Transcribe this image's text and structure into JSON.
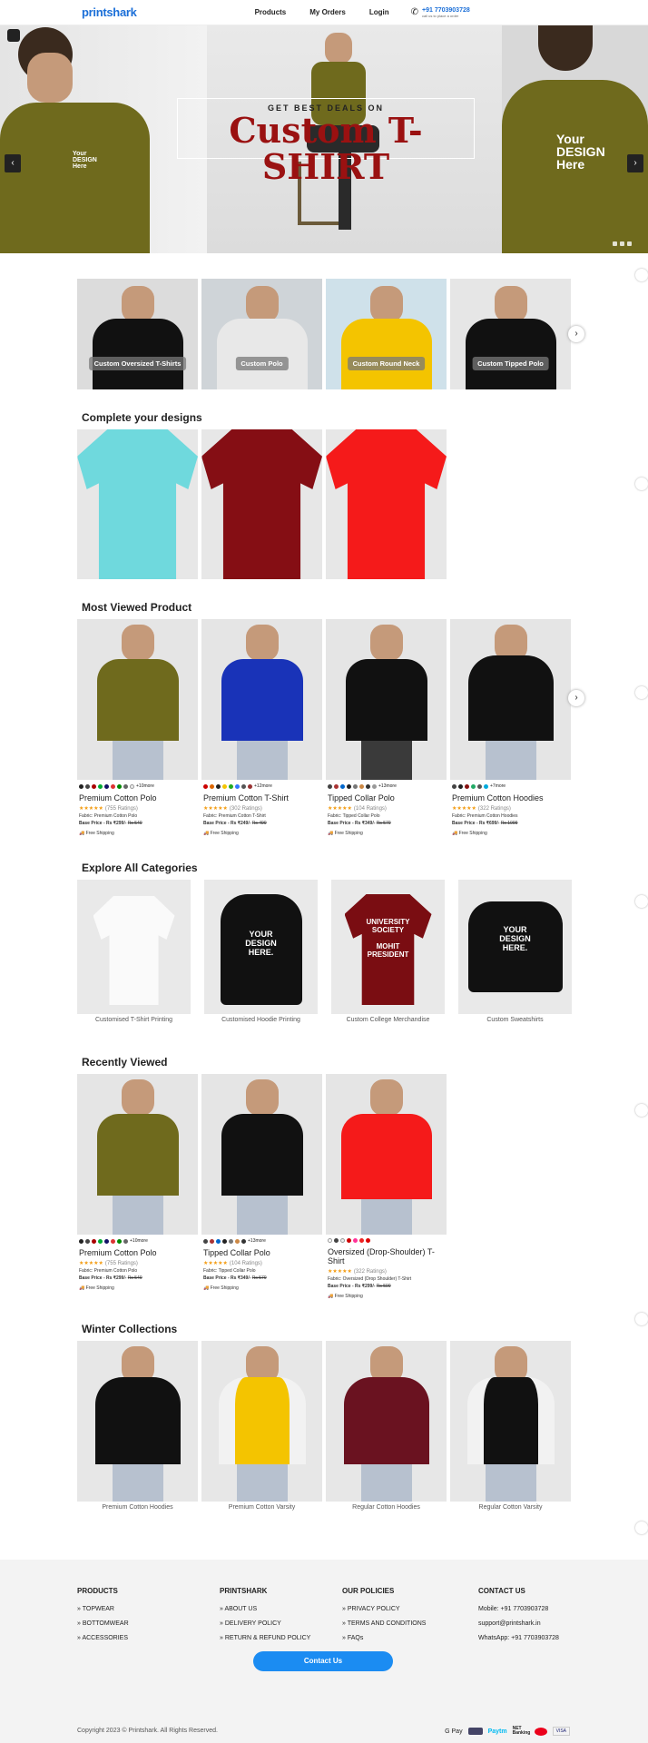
{
  "nav": {
    "logo": "printshark",
    "links": [
      "Products",
      "My Orders",
      "Login"
    ],
    "phone": "+91 7703903728",
    "phone_sub": "call us to place a order"
  },
  "hero": {
    "small": "GET BEST DEALS ON",
    "big": "Custom T-SHIRT",
    "prev": "‹",
    "next": "›"
  },
  "categories_strip": [
    "Custom Oversized T-Shirts",
    "Custom Polo",
    "Custom Round Neck",
    "Custom Tipped Polo"
  ],
  "complete": {
    "title": "Complete your designs"
  },
  "most_viewed": {
    "title": "Most Viewed Product",
    "items": [
      {
        "name": "Premium Cotton Polo",
        "ratings": "(755 Ratings)",
        "fabric": "Fabric: Premium Cotton Polo",
        "price": "Base Price - Rs ₹299/-",
        "old": "Rs 549",
        "more": "+10more",
        "ship": "Free Shipping",
        "colors": [
          "#222",
          "#444",
          "#a00",
          "#0a3",
          "#116",
          "#d33",
          "#080",
          "#666",
          "#eee"
        ]
      },
      {
        "name": "Premium Cotton T-Shirt",
        "ratings": "(302 Ratings)",
        "fabric": "Fabric: Premium Cotton T-Shirt",
        "price": "Base Price - Rs ₹249/-",
        "old": "Rs 499",
        "more": "+12more",
        "ship": "Free Shipping",
        "colors": [
          "#c00",
          "#d60",
          "#222",
          "#f4c400",
          "#2a2",
          "#37f",
          "#555",
          "#933"
        ]
      },
      {
        "name": "Tipped Collar Polo",
        "ratings": "(104 Ratings)",
        "fabric": "Fabric: Tipped Collar Polo",
        "price": "Base Price - Rs ₹349/-",
        "old": "Rs 579",
        "more": "+13more",
        "ship": "Free Shipping",
        "colors": [
          "#444",
          "#a33",
          "#06c",
          "#222",
          "#777",
          "#c84",
          "#333",
          "#999"
        ]
      },
      {
        "name": "Premium Cotton Hoodies",
        "ratings": "(322 Ratings)",
        "fabric": "Fabric: Premium Cotton Hoodies",
        "price": "Base Price - Rs ₹699/-",
        "old": "Rs 1099",
        "more": "+7more",
        "ship": "Free Shipping",
        "colors": [
          "#444",
          "#222",
          "#811",
          "#2a6",
          "#555",
          "#0ad"
        ]
      }
    ]
  },
  "explore": {
    "title": "Explore All Categories",
    "items": [
      "Customised T-Shirt Printing",
      "Customised Hoodie Printing",
      "Custom College Merchandise",
      "Custom Sweatshirts"
    ]
  },
  "recent": {
    "title": "Recently Viewed",
    "items": [
      {
        "name": "Premium Cotton Polo",
        "ratings": "(755 Ratings)",
        "fabric": "Fabric: Premium Cotton Polo",
        "price": "Base Price - Rs ₹299/-",
        "old": "Rs 549",
        "more": "+10more",
        "ship": "Free Shipping"
      },
      {
        "name": "Tipped Collar Polo",
        "ratings": "(104 Ratings)",
        "fabric": "Fabric: Tipped Collar Polo",
        "price": "Base Price - Rs ₹349/-",
        "old": "Rs 579",
        "more": "+13more",
        "ship": "Free Shipping"
      },
      {
        "name": "Oversized (Drop-Shoulder) T-Shirt",
        "ratings": "(322 Ratings)",
        "fabric": "Fabric: Oversized (Drop Shoulder) T-Shirt",
        "price": "Base Price - Rs ₹299/-",
        "old": "Rs 599",
        "more": "",
        "ship": "Free Shipping"
      }
    ]
  },
  "winter": {
    "title": "Winter Collections",
    "items": [
      "Premium Cotton Hoodies",
      "Premium Cotton Varsity",
      "Regular Cotton Hoodies",
      "Regular Cotton Varsity"
    ]
  },
  "footer": {
    "products": {
      "title": "PRODUCTS",
      "items": [
        "TOPWEAR",
        "BOTTOMWEAR",
        "ACCESSORIES"
      ]
    },
    "printshark": {
      "title": "PRINTSHARK",
      "items": [
        "ABOUT US",
        "DELIVERY POLICY",
        "RETURN & REFUND POLICY"
      ]
    },
    "policies": {
      "title": "OUR POLICIES",
      "items": [
        "PRIVACY POLICY",
        "TERMS AND CONDITIONS",
        "FAQs"
      ]
    },
    "contact": {
      "title": "CONTACT US",
      "items": [
        "Mobile: +91 7703903728",
        "support@printshark.in",
        "WhatsApp: +91 7703903728"
      ]
    },
    "button": "Contact Us",
    "copyright": "Copyright 2023 © Printshark. All Rights Reserved.",
    "payments": [
      "G Pay",
      "Paytm",
      "NET Banking",
      "VISA"
    ]
  }
}
